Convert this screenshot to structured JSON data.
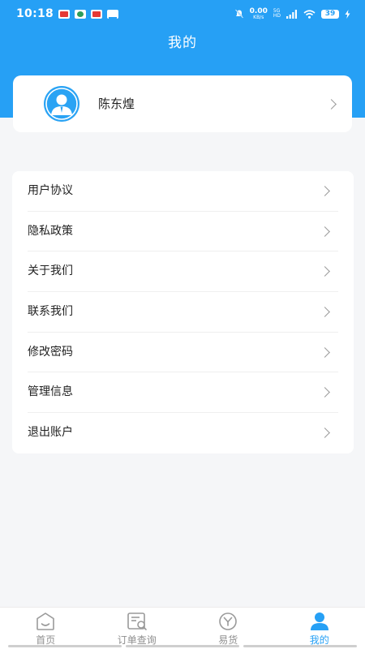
{
  "status_bar": {
    "time": "10:18",
    "net_speed_value": "0.00",
    "net_speed_unit": "KB/s",
    "signal_top": "5G",
    "signal_bottom": "HD",
    "battery": "39",
    "icons": [
      "calendar-icon",
      "mobile-network-icon",
      "app-badge-icon",
      "mail-icon",
      "mute-icon",
      "wifi-icon",
      "charging-icon"
    ]
  },
  "header": {
    "title": "我的",
    "color": "#26a0f5"
  },
  "user": {
    "name": "陈东煌",
    "avatar_icon": "user-avatar-icon"
  },
  "menu": {
    "items": [
      {
        "label": "用户协议"
      },
      {
        "label": "隐私政策"
      },
      {
        "label": "关于我们"
      },
      {
        "label": "联系我们"
      },
      {
        "label": "修改密码"
      },
      {
        "label": "管理信息"
      },
      {
        "label": "退出账户"
      }
    ]
  },
  "tab_bar": {
    "tabs": [
      {
        "label": "首页",
        "icon": "home-icon",
        "active": false
      },
      {
        "label": "订单查询",
        "icon": "order-search-icon",
        "active": false
      },
      {
        "label": "易货",
        "icon": "yi-circle-icon",
        "active": false
      },
      {
        "label": "我的",
        "icon": "profile-icon",
        "active": true
      }
    ],
    "active_color": "#26a0f5"
  }
}
